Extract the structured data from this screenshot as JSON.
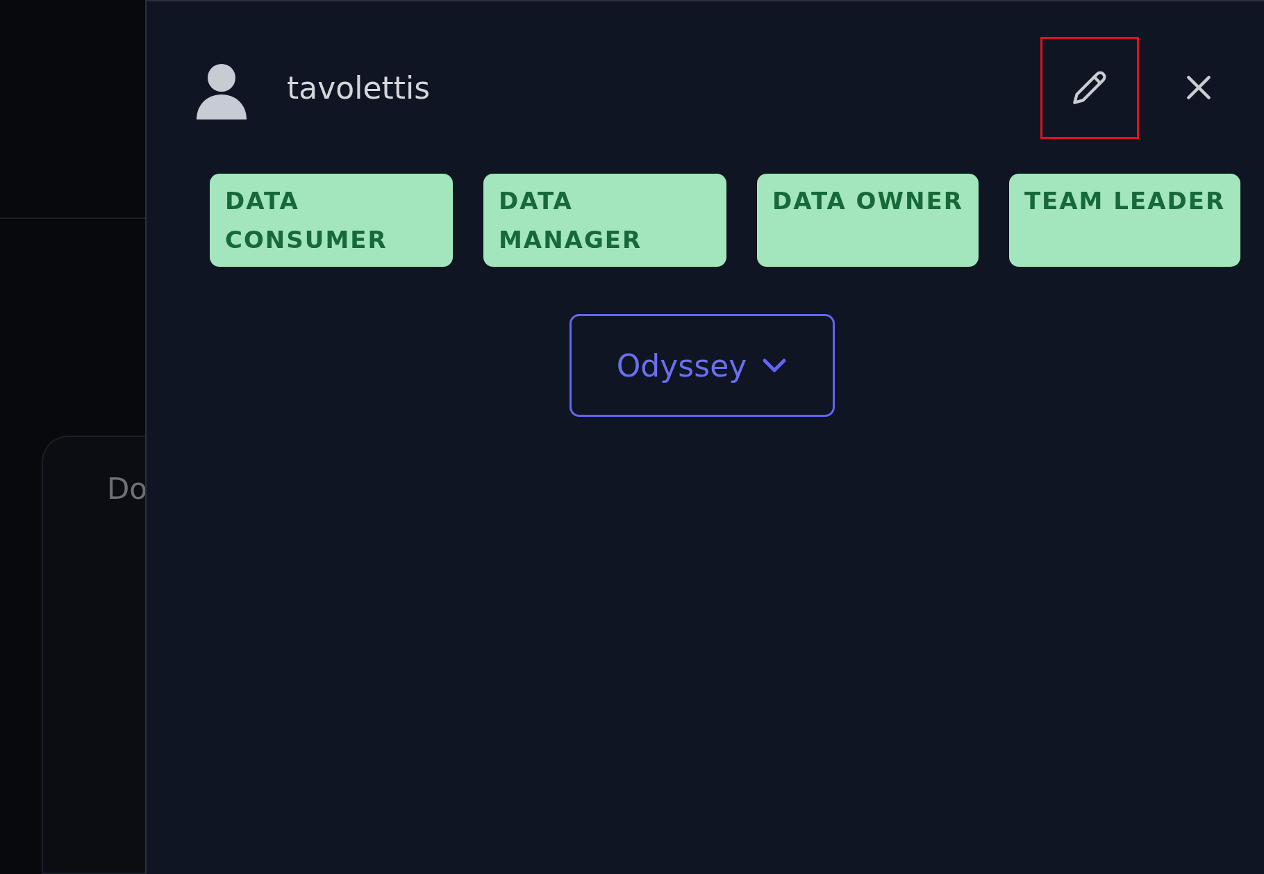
{
  "background": {
    "card_text": "Do"
  },
  "drawer": {
    "user": {
      "name": "tavolettis"
    },
    "edit_button": {
      "highlighted": true
    },
    "roles": [
      {
        "label": "DATA CONSUMER"
      },
      {
        "label": "DATA MANAGER"
      },
      {
        "label": "DATA OWNER"
      },
      {
        "label": "TEAM LEADER"
      }
    ],
    "workspace_dropdown": {
      "value": "Odyssey"
    }
  }
}
